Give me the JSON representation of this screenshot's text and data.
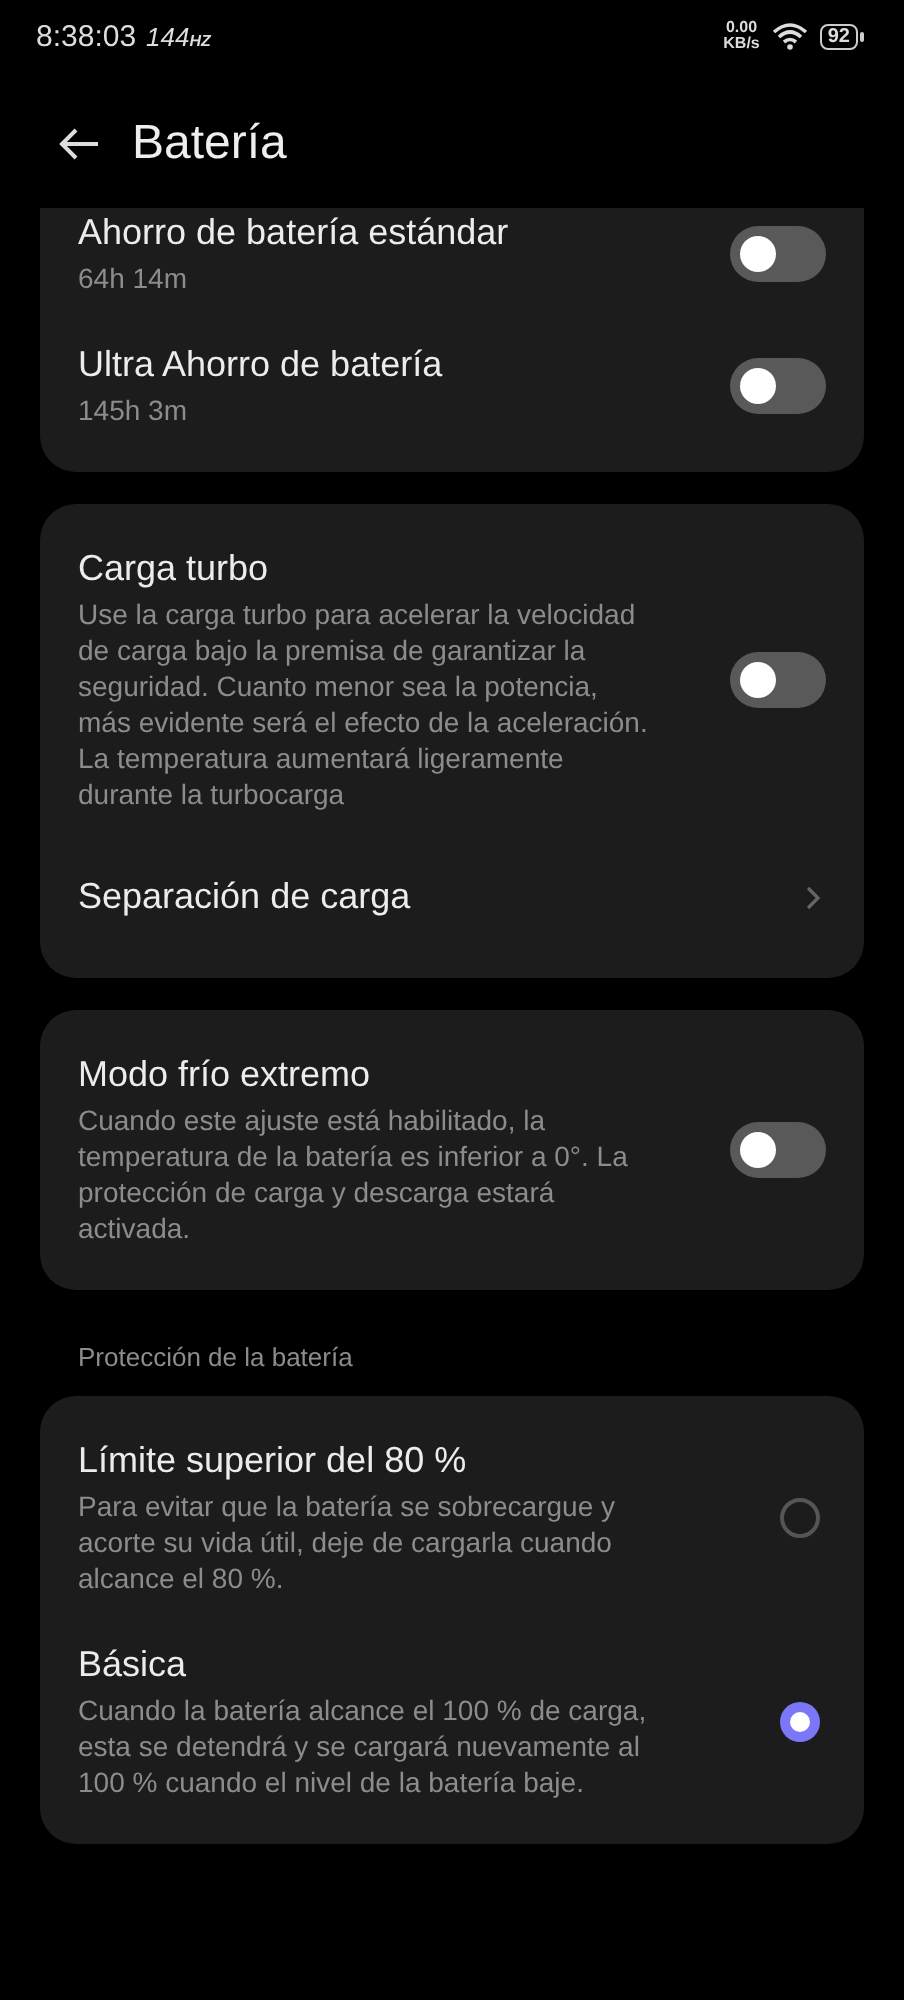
{
  "status_bar": {
    "time": "8:38:03",
    "refresh_rate": "144",
    "refresh_unit": "HZ",
    "net_speed": "0.00",
    "net_unit": "KB/s",
    "battery": "92"
  },
  "header": {
    "title": "Batería"
  },
  "sections": [
    {
      "items": [
        {
          "kind": "toggle",
          "title": "Ahorro de batería estándar",
          "subtitle": "64h 14m",
          "on": false
        },
        {
          "kind": "toggle",
          "title": "Ultra Ahorro de batería",
          "subtitle": "145h 3m",
          "on": false
        }
      ]
    },
    {
      "items": [
        {
          "kind": "toggle",
          "title": "Carga turbo",
          "subtitle": "Use la carga turbo para acelerar la velocidad de carga bajo la premisa de garantizar la seguridad. Cuanto menor sea la potencia, más evidente será el efecto de la aceleración. La temperatura aumentará ligeramente durante la turbocarga",
          "on": false
        },
        {
          "kind": "link",
          "title": "Separación de carga"
        }
      ]
    },
    {
      "items": [
        {
          "kind": "toggle",
          "title": "Modo frío extremo",
          "subtitle": "Cuando este ajuste está habilitado, la temperatura de la batería es inferior a 0°. La protección de carga y descarga estará activada.",
          "on": false
        }
      ]
    },
    {
      "header": "Protección de la batería",
      "items": [
        {
          "kind": "radio",
          "title": "Límite superior del 80 %",
          "subtitle": "Para evitar que la batería se sobrecargue y acorte su vida útil, deje de cargarla cuando alcance el 80 %.",
          "selected": false
        },
        {
          "kind": "radio",
          "title": "Básica",
          "subtitle": "Cuando la batería alcance el 100 % de carga, esta se detendrá y se cargará nuevamente al 100 % cuando el nivel de la batería baje.",
          "selected": true
        }
      ]
    }
  ]
}
